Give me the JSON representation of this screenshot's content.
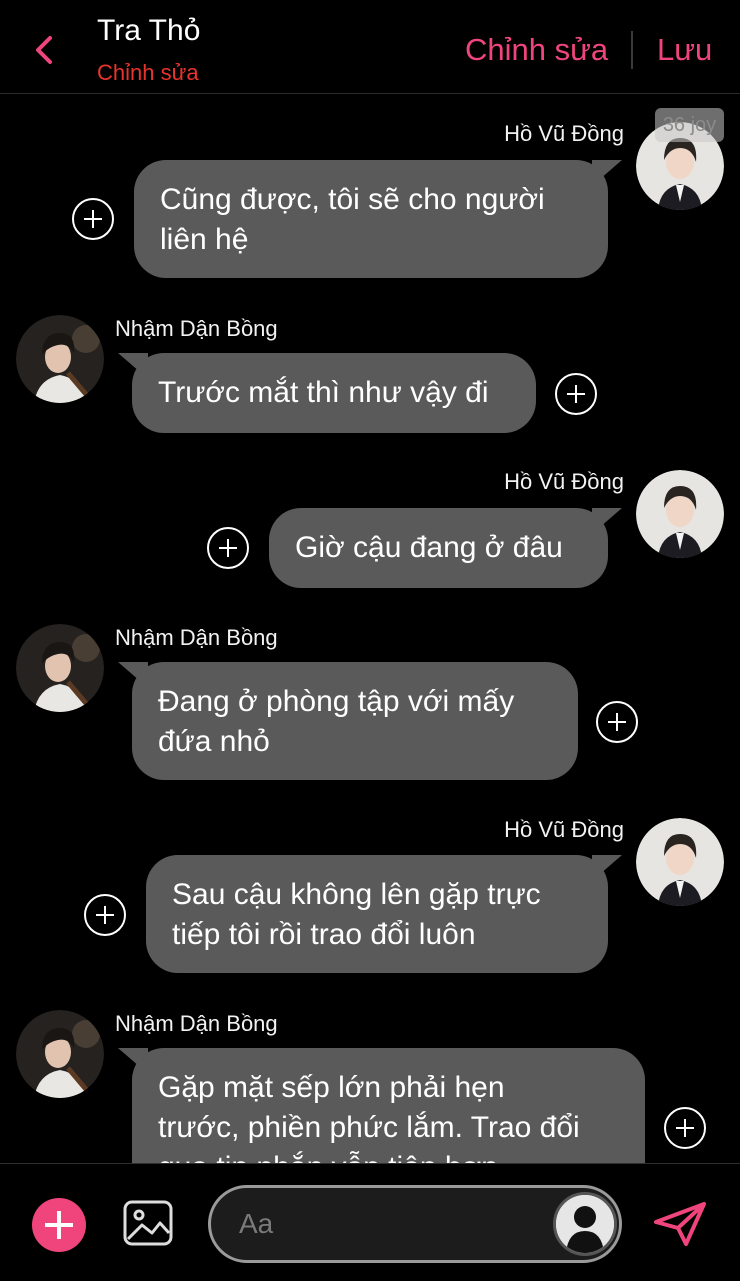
{
  "header": {
    "title": "Tra Thỏ",
    "subtitle": "Chỉnh sửa",
    "edit_label": "Chỉnh sửa",
    "save_label": "Lưu"
  },
  "watermark": "36 joy",
  "messages": [
    {
      "sender": "Hồ Vũ Đồng",
      "side": "right",
      "lines": [
        "Cũng được, tôi sẽ cho người",
        "liên hệ"
      ]
    },
    {
      "sender": "Nhậm Dận Bồng",
      "side": "left",
      "lines": [
        "Trước mắt thì như vậy đi"
      ]
    },
    {
      "sender": "Hồ Vũ Đồng",
      "side": "right",
      "lines": [
        "Giờ cậu đang ở đâu"
      ]
    },
    {
      "sender": "Nhậm Dận Bồng",
      "side": "left",
      "lines": [
        "Đang ở phòng tập với mấy",
        "đứa nhỏ"
      ]
    },
    {
      "sender": "Hồ Vũ Đồng",
      "side": "right",
      "lines": [
        "Sau cậu không lên gặp trực",
        "tiếp tôi rồi trao đổi luôn"
      ]
    },
    {
      "sender": "Nhậm Dận Bồng",
      "side": "left",
      "lines": [
        "Gặp mặt sếp lớn phải hẹn",
        "trước, phiền phức lắm. Trao đổi",
        "qua tin nhắn vẫn tiện hơn"
      ]
    }
  ],
  "composer": {
    "placeholder": "Aa"
  },
  "colors": {
    "accent": "#f0457c",
    "subtitle": "#e8342c",
    "bubble": "#5a5a5a",
    "background": "#000000"
  }
}
